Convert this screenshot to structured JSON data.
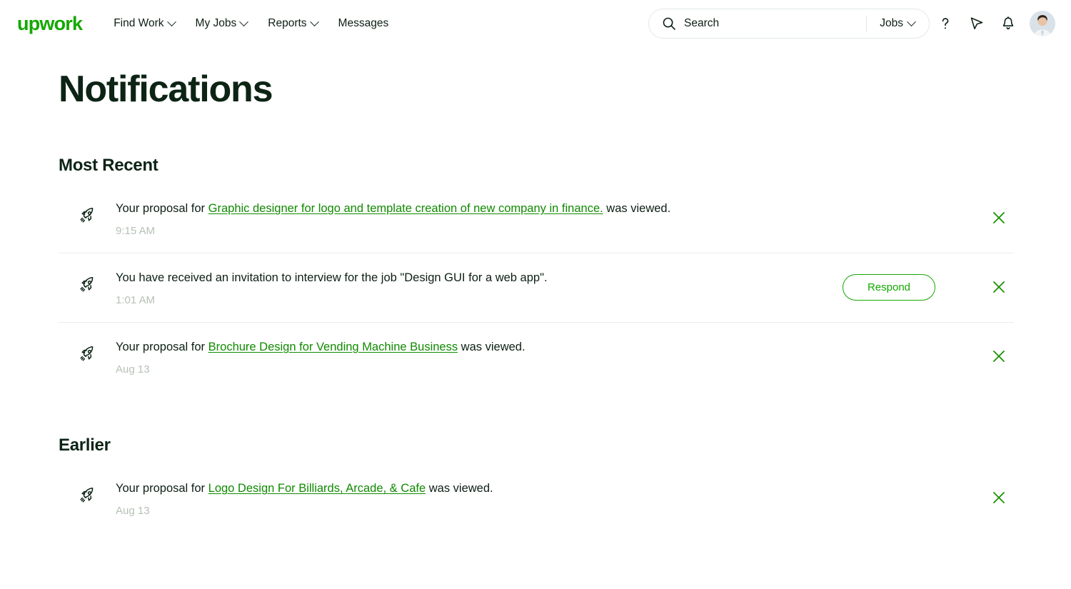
{
  "header": {
    "logo_text": "upwork",
    "nav": [
      {
        "label": "Find Work",
        "has_caret": true
      },
      {
        "label": "My Jobs",
        "has_caret": true
      },
      {
        "label": "Reports",
        "has_caret": true
      },
      {
        "label": "Messages",
        "has_caret": false
      }
    ],
    "search": {
      "placeholder": "Search",
      "value": "",
      "scope_label": "Jobs",
      "icon": "search-icon"
    },
    "icons": [
      {
        "name": "help-icon",
        "glyph": "?"
      },
      {
        "name": "cursor-icon",
        "glyph": "arrow-pointer"
      },
      {
        "name": "notifications-bell-icon",
        "glyph": "bell"
      }
    ],
    "avatar_alt": "user-avatar"
  },
  "page": {
    "title": "Notifications"
  },
  "sections": [
    {
      "heading": "Most Recent",
      "items": [
        {
          "icon": "rocket-icon",
          "text_before": "Your proposal for ",
          "link": "Graphic designer for logo and template creation of new company in finance.",
          "text_after": " was viewed.",
          "time": "9:15 AM",
          "action_label": null,
          "dismiss": "close-icon",
          "divider_below": true
        },
        {
          "icon": "rocket-icon",
          "text_before": "You have received an invitation to interview for the job \"Design GUI for a web app\".",
          "link": null,
          "text_after": "",
          "time": "1:01 AM",
          "action_label": "Respond",
          "dismiss": "close-icon",
          "divider_below": true
        },
        {
          "icon": "rocket-icon",
          "text_before": "Your proposal for ",
          "link": "Brochure Design for Vending Machine Business",
          "text_after": " was viewed.",
          "time": "Aug 13",
          "action_label": null,
          "dismiss": "close-icon",
          "divider_below": false
        }
      ]
    },
    {
      "heading": "Earlier",
      "items": [
        {
          "icon": "rocket-icon",
          "text_before": "Your proposal for ",
          "link": "Logo Design For Billiards, Arcade, & Cafe",
          "text_after": " was viewed.",
          "time": "Aug 13",
          "action_label": null,
          "dismiss": "close-icon",
          "divider_below": false
        }
      ]
    }
  ],
  "colors": {
    "brand_green": "#14a800",
    "link_green": "#108a00",
    "text_dark": "#0d1f14",
    "muted": "#b6c2b6",
    "divider": "#e8eee8"
  }
}
